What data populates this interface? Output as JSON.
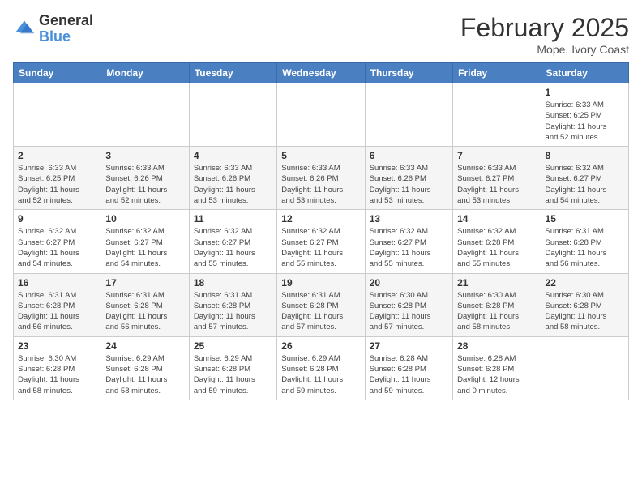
{
  "header": {
    "logo_general": "General",
    "logo_blue": "Blue",
    "month_title": "February 2025",
    "location": "Mope, Ivory Coast"
  },
  "weekdays": [
    "Sunday",
    "Monday",
    "Tuesday",
    "Wednesday",
    "Thursday",
    "Friday",
    "Saturday"
  ],
  "weeks": [
    [
      {
        "day": "",
        "info": ""
      },
      {
        "day": "",
        "info": ""
      },
      {
        "day": "",
        "info": ""
      },
      {
        "day": "",
        "info": ""
      },
      {
        "day": "",
        "info": ""
      },
      {
        "day": "",
        "info": ""
      },
      {
        "day": "1",
        "info": "Sunrise: 6:33 AM\nSunset: 6:25 PM\nDaylight: 11 hours\nand 52 minutes."
      }
    ],
    [
      {
        "day": "2",
        "info": "Sunrise: 6:33 AM\nSunset: 6:25 PM\nDaylight: 11 hours\nand 52 minutes."
      },
      {
        "day": "3",
        "info": "Sunrise: 6:33 AM\nSunset: 6:26 PM\nDaylight: 11 hours\nand 52 minutes."
      },
      {
        "day": "4",
        "info": "Sunrise: 6:33 AM\nSunset: 6:26 PM\nDaylight: 11 hours\nand 53 minutes."
      },
      {
        "day": "5",
        "info": "Sunrise: 6:33 AM\nSunset: 6:26 PM\nDaylight: 11 hours\nand 53 minutes."
      },
      {
        "day": "6",
        "info": "Sunrise: 6:33 AM\nSunset: 6:26 PM\nDaylight: 11 hours\nand 53 minutes."
      },
      {
        "day": "7",
        "info": "Sunrise: 6:33 AM\nSunset: 6:27 PM\nDaylight: 11 hours\nand 53 minutes."
      },
      {
        "day": "8",
        "info": "Sunrise: 6:32 AM\nSunset: 6:27 PM\nDaylight: 11 hours\nand 54 minutes."
      }
    ],
    [
      {
        "day": "9",
        "info": "Sunrise: 6:32 AM\nSunset: 6:27 PM\nDaylight: 11 hours\nand 54 minutes."
      },
      {
        "day": "10",
        "info": "Sunrise: 6:32 AM\nSunset: 6:27 PM\nDaylight: 11 hours\nand 54 minutes."
      },
      {
        "day": "11",
        "info": "Sunrise: 6:32 AM\nSunset: 6:27 PM\nDaylight: 11 hours\nand 55 minutes."
      },
      {
        "day": "12",
        "info": "Sunrise: 6:32 AM\nSunset: 6:27 PM\nDaylight: 11 hours\nand 55 minutes."
      },
      {
        "day": "13",
        "info": "Sunrise: 6:32 AM\nSunset: 6:27 PM\nDaylight: 11 hours\nand 55 minutes."
      },
      {
        "day": "14",
        "info": "Sunrise: 6:32 AM\nSunset: 6:28 PM\nDaylight: 11 hours\nand 55 minutes."
      },
      {
        "day": "15",
        "info": "Sunrise: 6:31 AM\nSunset: 6:28 PM\nDaylight: 11 hours\nand 56 minutes."
      }
    ],
    [
      {
        "day": "16",
        "info": "Sunrise: 6:31 AM\nSunset: 6:28 PM\nDaylight: 11 hours\nand 56 minutes."
      },
      {
        "day": "17",
        "info": "Sunrise: 6:31 AM\nSunset: 6:28 PM\nDaylight: 11 hours\nand 56 minutes."
      },
      {
        "day": "18",
        "info": "Sunrise: 6:31 AM\nSunset: 6:28 PM\nDaylight: 11 hours\nand 57 minutes."
      },
      {
        "day": "19",
        "info": "Sunrise: 6:31 AM\nSunset: 6:28 PM\nDaylight: 11 hours\nand 57 minutes."
      },
      {
        "day": "20",
        "info": "Sunrise: 6:30 AM\nSunset: 6:28 PM\nDaylight: 11 hours\nand 57 minutes."
      },
      {
        "day": "21",
        "info": "Sunrise: 6:30 AM\nSunset: 6:28 PM\nDaylight: 11 hours\nand 58 minutes."
      },
      {
        "day": "22",
        "info": "Sunrise: 6:30 AM\nSunset: 6:28 PM\nDaylight: 11 hours\nand 58 minutes."
      }
    ],
    [
      {
        "day": "23",
        "info": "Sunrise: 6:30 AM\nSunset: 6:28 PM\nDaylight: 11 hours\nand 58 minutes."
      },
      {
        "day": "24",
        "info": "Sunrise: 6:29 AM\nSunset: 6:28 PM\nDaylight: 11 hours\nand 58 minutes."
      },
      {
        "day": "25",
        "info": "Sunrise: 6:29 AM\nSunset: 6:28 PM\nDaylight: 11 hours\nand 59 minutes."
      },
      {
        "day": "26",
        "info": "Sunrise: 6:29 AM\nSunset: 6:28 PM\nDaylight: 11 hours\nand 59 minutes."
      },
      {
        "day": "27",
        "info": "Sunrise: 6:28 AM\nSunset: 6:28 PM\nDaylight: 11 hours\nand 59 minutes."
      },
      {
        "day": "28",
        "info": "Sunrise: 6:28 AM\nSunset: 6:28 PM\nDaylight: 12 hours\nand 0 minutes."
      },
      {
        "day": "",
        "info": ""
      }
    ]
  ]
}
